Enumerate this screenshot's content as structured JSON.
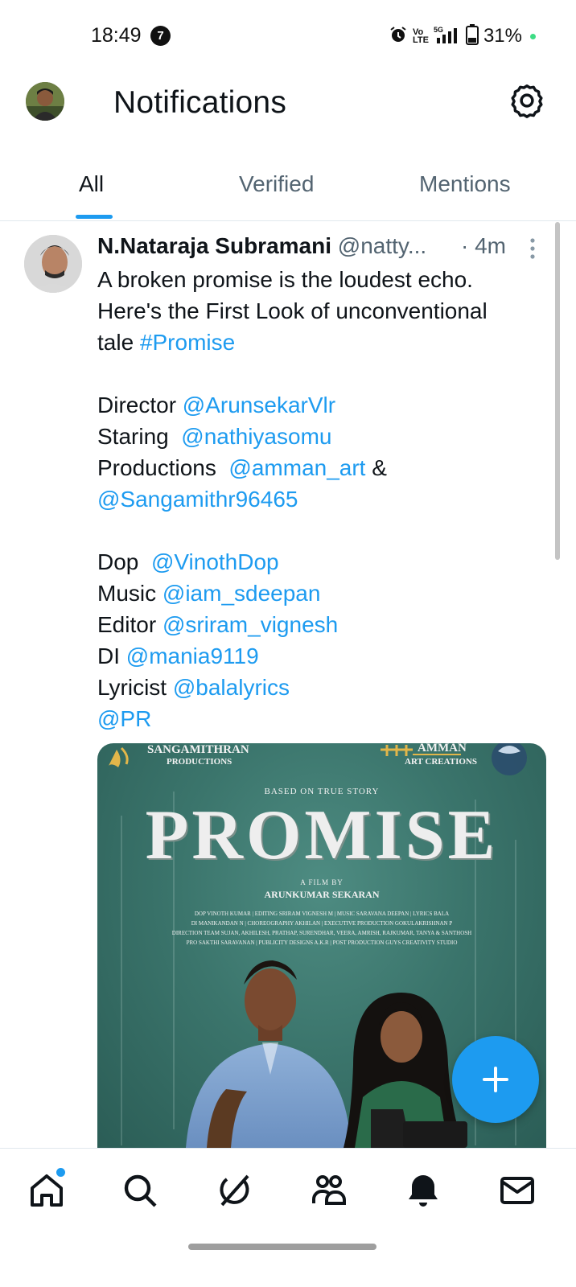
{
  "status_bar": {
    "time": "18:49",
    "notification_count": "7",
    "network_label": "Vo LTE",
    "signal_label": "5G",
    "battery": "31%"
  },
  "header": {
    "title": "Notifications",
    "avatar_icon": "profile-avatar",
    "settings_icon": "gear-icon"
  },
  "tabs": [
    {
      "label": "All",
      "active": true
    },
    {
      "label": "Verified",
      "active": false
    },
    {
      "label": "Mentions",
      "active": false
    }
  ],
  "tweet": {
    "author_name": "N.Nataraja Subramani",
    "handle": "@natty...",
    "time": "· 4m",
    "lines": [
      {
        "parts": [
          {
            "text": "A broken promise is the loudest echo."
          }
        ]
      },
      {
        "parts": [
          {
            "text": "Here's the First Look of unconventional"
          }
        ]
      },
      {
        "parts": [
          {
            "text": "tale "
          },
          {
            "text": "#Promise",
            "link": true
          }
        ]
      },
      {
        "blank": true
      },
      {
        "parts": [
          {
            "text": "Director "
          },
          {
            "text": "@ArunsekarVlr",
            "link": true
          }
        ]
      },
      {
        "parts": [
          {
            "text": "Staring  "
          },
          {
            "text": "@nathiyasomu",
            "link": true
          }
        ]
      },
      {
        "parts": [
          {
            "text": "Productions  "
          },
          {
            "text": "@amman_art",
            "link": true
          },
          {
            "text": " &"
          }
        ]
      },
      {
        "parts": [
          {
            "text": "@Sangamithr96465",
            "link": true
          }
        ]
      },
      {
        "blank": true
      },
      {
        "parts": [
          {
            "text": "Dop  "
          },
          {
            "text": "@VinothDop",
            "link": true
          }
        ]
      },
      {
        "parts": [
          {
            "text": "Music "
          },
          {
            "text": "@iam_sdeepan",
            "link": true
          }
        ]
      },
      {
        "parts": [
          {
            "text": "Editor "
          },
          {
            "text": "@sriram_vignesh",
            "link": true
          }
        ]
      },
      {
        "parts": [
          {
            "text": "DI "
          },
          {
            "text": "@mania9119",
            "link": true
          }
        ]
      },
      {
        "parts": [
          {
            "text": "Lyricist "
          },
          {
            "text": "@balalyrics",
            "link": true
          }
        ]
      },
      {
        "parts": [
          {
            "text": "@PR",
            "link": true
          }
        ]
      }
    ],
    "poster": {
      "left_logo_line1": "SANGAMITHRAN",
      "left_logo_line2": "PRODUCTIONS",
      "right_logo_line1": "AMMAN",
      "right_logo_line2": "ART CREATIONS",
      "tagline": "BASED ON TRUE STORY",
      "title": "PROMISE",
      "film_by": "A FILM BY",
      "director": "ARUNKUMAR SEKARAN",
      "credits": [
        "DOP VINOTH KUMAR  |  EDITING SRIRAM VIGNESH M  |  MUSIC SARAVANA DEEPAN  |  LYRICS BALA",
        "DI MANIKANDAN N  |  CHOREOGRAPHY AKHILAN  |  EXECUTIVE PRODUCTION GOKULAKRISHNAN P",
        "DIRECTION TEAM SUJAN, AKHILESH, PRATHAP, SURENDHAR, VEERA, AMRISH, RAJKUMAR, TANYA & SANTHOSH",
        "PRO SAKTHI SARAVANAN  |  PUBLICITY DESIGNS A.K.R  |  POST PRODUCTION GUYS CREATIVITY STUDIO"
      ]
    }
  },
  "fab": {
    "icon": "plus-icon"
  },
  "bottom_nav": [
    {
      "name": "home-icon",
      "has_dot": true
    },
    {
      "name": "search-icon"
    },
    {
      "name": "grok-icon"
    },
    {
      "name": "communities-icon"
    },
    {
      "name": "notifications-bell-icon"
    },
    {
      "name": "messages-icon"
    }
  ]
}
